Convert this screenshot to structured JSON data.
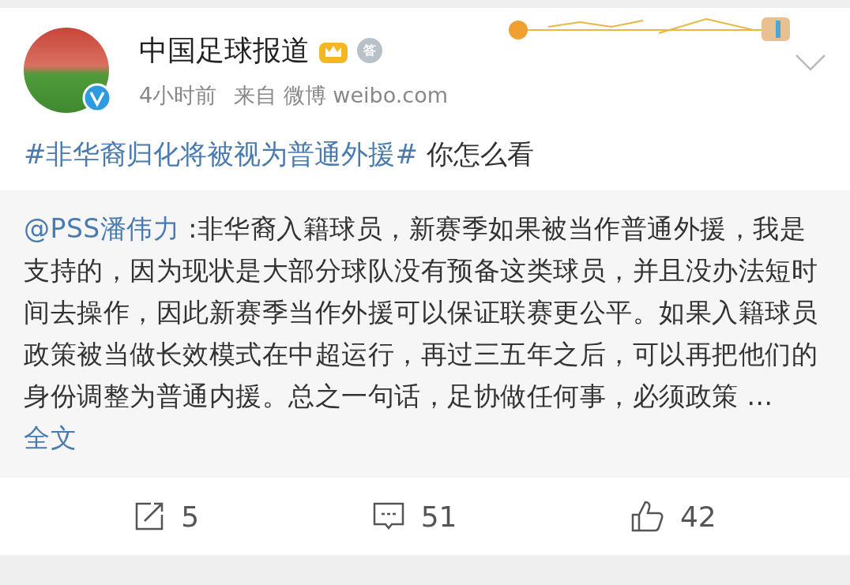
{
  "post": {
    "author": "中国足球报道",
    "medal_badge": "答",
    "time": "4小时前",
    "source_prefix": "来自",
    "source": "微博 weibo.com",
    "hashtag": "#非华裔归化将被视为普通外援#",
    "text": "你怎么看"
  },
  "repost": {
    "mention": "@PSS潘伟力",
    "text": ":非华裔入籍球员，新赛季如果被当作普通外援，我是支持的，因为现状是大部分球队没有预备这类球员，并且没办法短时间去操作，因此新赛季当作外援可以保证联赛更公平。如果入籍球员政策被当做长效模式在中超运行，再过三五年之后，可以再把他们的身份调整为普通内援。总之一句话，足协做任何事，必须政策 ...",
    "more": "全文"
  },
  "actions": [
    {
      "kind": "share",
      "count": "5"
    },
    {
      "kind": "comment",
      "count": "51"
    },
    {
      "kind": "like",
      "count": "42"
    }
  ]
}
